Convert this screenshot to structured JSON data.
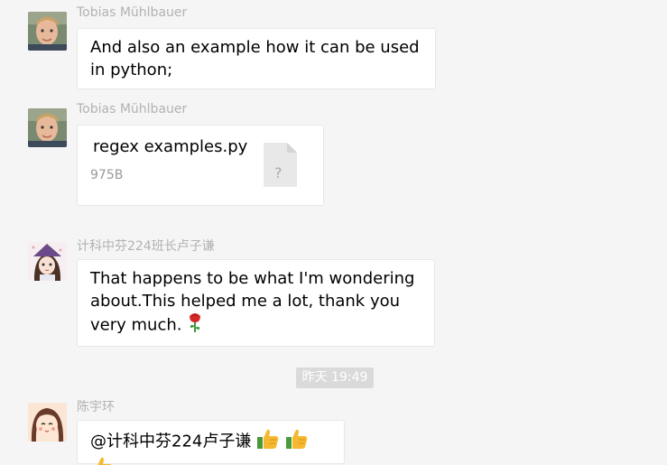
{
  "messages": [
    {
      "sender": "Tobias Mühlbauer",
      "text": "And also an example how it can be used in python;"
    },
    {
      "sender": "Tobias Mühlbauer",
      "file": {
        "name": "regex examples.py",
        "size": "975B",
        "icon_glyph": "?"
      }
    },
    {
      "sender": "计科中芬224班长卢子谦",
      "text": "That happens to be what I'm wondering about.This helped me a lot, thank you very much."
    },
    {
      "sender": "陈宇环",
      "text": "@计科中芬224卢子谦"
    }
  ],
  "timestamp": "昨天 19:49",
  "icons": {
    "rose": "rose-emoji",
    "thumbs": "thumbs-up-emoji"
  },
  "colors": {
    "background": "#f5f5f5",
    "bubble": "#ffffff",
    "sender": "#b2b2b2",
    "timestamp_bg": "#dadada"
  }
}
